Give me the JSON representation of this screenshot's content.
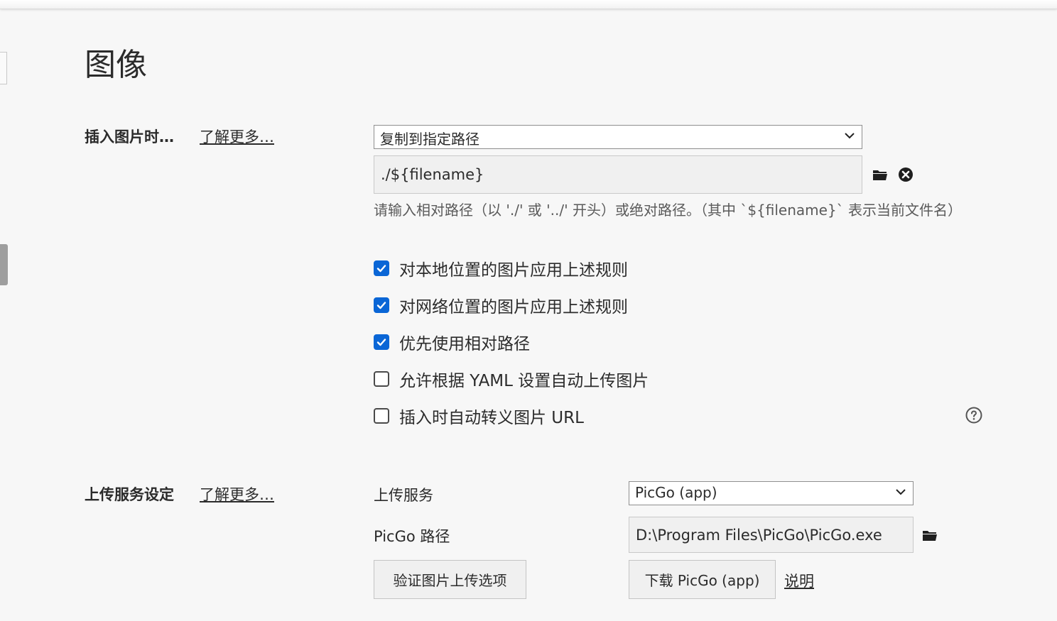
{
  "page": {
    "title": "图像"
  },
  "insert_image": {
    "label": "插入图片时…",
    "learn_more": "了解更多…",
    "action_select": "复制到指定路径",
    "path_value": "./${filename}",
    "hint": "请输入相对路径（以 './' 或 '../' 开头）或绝对路径。（其中 `${filename}` 表示当前文件名）",
    "checkboxes": [
      {
        "label": "对本地位置的图片应用上述规则",
        "checked": true
      },
      {
        "label": "对网络位置的图片应用上述规则",
        "checked": true
      },
      {
        "label": "优先使用相对路径",
        "checked": true
      },
      {
        "label": "允许根据 YAML 设置自动上传图片",
        "checked": false
      },
      {
        "label": "插入时自动转义图片 URL",
        "checked": false
      }
    ]
  },
  "upload": {
    "label": "上传服务设定",
    "learn_more": "了解更多…",
    "service_label": "上传服务",
    "service_value": "PicGo (app)",
    "path_label": "PicGo 路径",
    "path_value": "D:\\Program Files\\PicGo\\PicGo.exe",
    "verify_button": "验证图片上传选项",
    "download_button": "下载 PicGo (app)",
    "explain_link": "说明"
  },
  "colors": {
    "accent": "#0a66d6",
    "background": "#f7f7f7"
  },
  "icons": [
    "folder-icon",
    "clear-icon",
    "help-icon",
    "chevron-down-icon",
    "checkmark-icon"
  ]
}
